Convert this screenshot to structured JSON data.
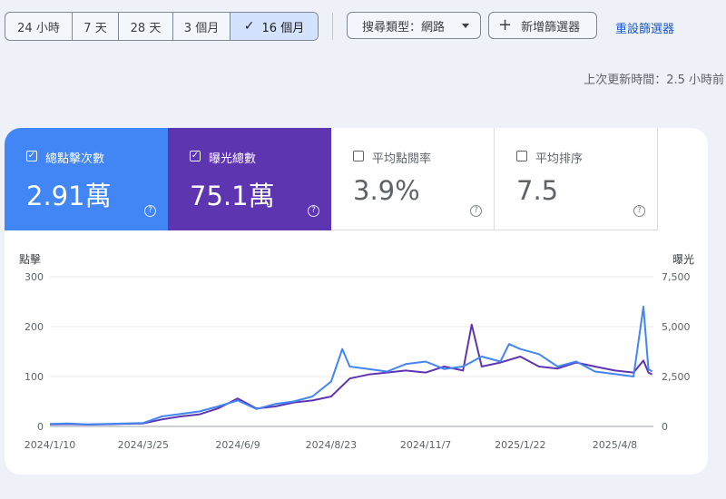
{
  "toolbar": {
    "date_ranges": [
      {
        "label": "24 小時",
        "selected": false
      },
      {
        "label": "7 天",
        "selected": false
      },
      {
        "label": "28 天",
        "selected": false
      },
      {
        "label": "3 個月",
        "selected": false
      },
      {
        "label": "16 個月",
        "selected": true
      }
    ],
    "search_type_label": "搜尋類型：網路",
    "add_filter_label": "新增篩選器",
    "reset_filter_label": "重設篩選器"
  },
  "last_updated": "上次更新時間：2.5 小時前",
  "metrics": [
    {
      "label": "總點擊次數",
      "value": "2.91萬",
      "checked": true,
      "color": "#4285f4"
    },
    {
      "label": "曝光總數",
      "value": "75.1萬",
      "checked": true,
      "color": "#5e35b1"
    },
    {
      "label": "平均點閱率",
      "value": "3.9%",
      "checked": false
    },
    {
      "label": "平均排序",
      "value": "7.5",
      "checked": false
    }
  ],
  "chart_data": {
    "type": "line",
    "ylabel_left": "點擊",
    "ylabel_right": "曝光",
    "y_left_ticks": [
      "0",
      "100",
      "200",
      "300"
    ],
    "y_right_ticks": [
      "0",
      "2,500",
      "5,000",
      "7,500"
    ],
    "ylim_left": [
      0,
      300
    ],
    "ylim_right": [
      0,
      7500
    ],
    "x_ticks": [
      "2024/1/10",
      "2024/3/25",
      "2024/6/9",
      "2024/8/23",
      "2024/11/7",
      "2025/1/22",
      "2025/4/8"
    ],
    "grid": true,
    "series": [
      {
        "axis": "left",
        "color": "#4285f4",
        "x": [
          "2024-01-10",
          "2024-01-25",
          "2024-02-09",
          "2024-02-24",
          "2024-03-10",
          "2024-03-25",
          "2024-04-09",
          "2024-04-24",
          "2024-05-09",
          "2024-05-24",
          "2024-06-09",
          "2024-06-24",
          "2024-07-09",
          "2024-07-24",
          "2024-08-08",
          "2024-08-23",
          "2024-09-01",
          "2024-09-07",
          "2024-09-22",
          "2024-10-07",
          "2024-10-22",
          "2024-11-07",
          "2024-11-22",
          "2024-12-07",
          "2024-12-22",
          "2025-01-06",
          "2025-01-13",
          "2025-01-22",
          "2025-02-06",
          "2025-02-21",
          "2025-03-08",
          "2025-03-23",
          "2025-04-08",
          "2025-04-23",
          "2025-05-01",
          "2025-05-05",
          "2025-05-08"
        ],
        "values": [
          5,
          6,
          4,
          5,
          6,
          7,
          20,
          25,
          30,
          40,
          52,
          35,
          45,
          50,
          60,
          90,
          155,
          120,
          115,
          110,
          125,
          130,
          115,
          120,
          140,
          130,
          165,
          155,
          145,
          120,
          130,
          110,
          105,
          100,
          240,
          115,
          110
        ]
      },
      {
        "axis": "right",
        "color": "#5e35b1",
        "x": [
          "2024-01-10",
          "2024-01-25",
          "2024-02-09",
          "2024-02-24",
          "2024-03-10",
          "2024-03-25",
          "2024-04-09",
          "2024-04-24",
          "2024-05-09",
          "2024-05-24",
          "2024-06-09",
          "2024-06-24",
          "2024-07-09",
          "2024-07-24",
          "2024-08-08",
          "2024-08-23",
          "2024-09-07",
          "2024-09-22",
          "2024-10-07",
          "2024-10-22",
          "2024-11-07",
          "2024-11-22",
          "2024-12-07",
          "2024-12-14",
          "2024-12-22",
          "2025-01-06",
          "2025-01-22",
          "2025-02-06",
          "2025-02-21",
          "2025-03-08",
          "2025-03-23",
          "2025-04-08",
          "2025-04-23",
          "2025-05-01",
          "2025-05-05",
          "2025-05-08"
        ],
        "values": [
          100,
          120,
          90,
          110,
          130,
          150,
          350,
          500,
          600,
          900,
          1400,
          900,
          1000,
          1200,
          1300,
          1500,
          2400,
          2600,
          2700,
          2800,
          2700,
          3000,
          2800,
          5100,
          3000,
          3200,
          3500,
          3000,
          2900,
          3200,
          3000,
          2800,
          2700,
          3300,
          2700,
          2600
        ]
      }
    ]
  }
}
